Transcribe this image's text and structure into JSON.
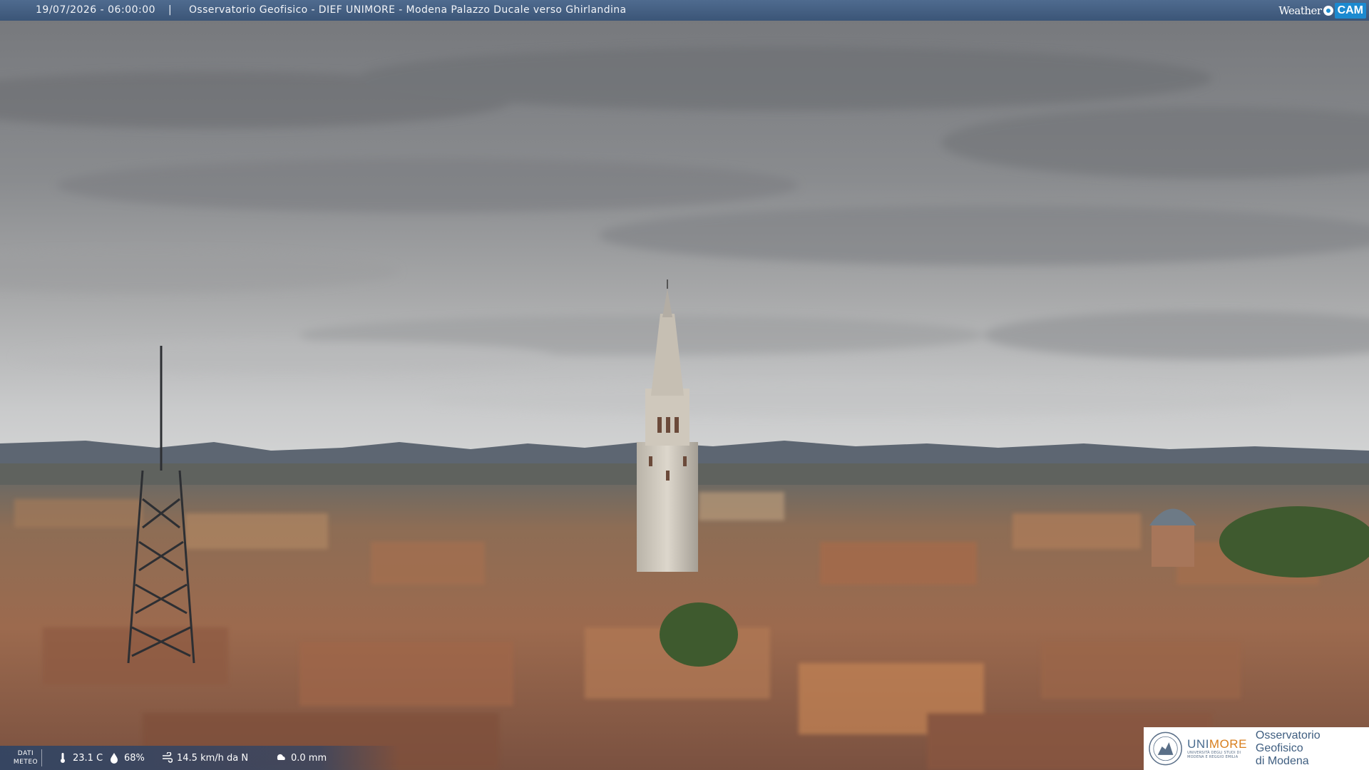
{
  "header": {
    "timestamp": "19/07/2026 - 06:00:00",
    "separator": "|",
    "title": "Osservatorio Geofisico - DIEF UNIMORE - Modena Palazzo Ducale verso Ghirlandina",
    "brand_weather": "Weather",
    "brand_cam": "CAM"
  },
  "meteo": {
    "label_line1": "DATI",
    "label_line2": "METEO",
    "temperature": "23.1 C",
    "humidity": "68%",
    "wind": "14.5 km/h da N",
    "rain": "0.0 mm"
  },
  "logo": {
    "uni_part1": "UNI",
    "uni_part2": "MORE",
    "uni_sub_line1": "UNIVERSITÀ DEGLI STUDI DI",
    "uni_sub_line2": "MODENA E REGGIO EMILIA",
    "observatory_line1": "Osservatorio Geofisico",
    "observatory_line2": "di Modena"
  },
  "colors": {
    "top_bar": "#3f5a7e",
    "meteo_bar": "#304464",
    "brand_cam": "#1c8ad0",
    "uni_blue": "#4a6c8f",
    "uni_orange": "#d87e1d"
  }
}
